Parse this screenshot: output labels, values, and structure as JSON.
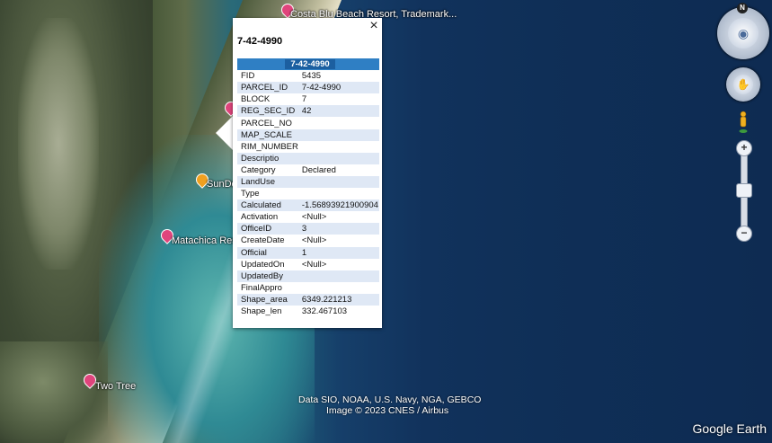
{
  "map": {
    "places": [
      {
        "name": "Costa Blu Beach Resort, Trademark...",
        "color": "#e0447c"
      },
      {
        "name": "SunDe",
        "color": "#f0a020"
      },
      {
        "name": "Matachica Resor",
        "color": "#e0447c"
      },
      {
        "name": "Two Tree",
        "color": "#e0447c"
      }
    ],
    "credits": {
      "line1": "Data SIO, NOAA, U.S. Navy, NGA, GEBCO",
      "line2": "Image © 2023 CNES / Airbus"
    },
    "logo": "Google Earth"
  },
  "popup": {
    "title": "7-42-4990",
    "header": "7-42-4990",
    "close_icon": "×",
    "rows": [
      {
        "key": "FID",
        "value": "5435"
      },
      {
        "key": "PARCEL_ID",
        "value": "7-42-4990"
      },
      {
        "key": "BLOCK",
        "value": "7"
      },
      {
        "key": "REG_SEC_ID",
        "value": "42"
      },
      {
        "key": "PARCEL_NO",
        "value": ""
      },
      {
        "key": "MAP_SCALE",
        "value": ""
      },
      {
        "key": "RIM_NUMBER",
        "value": ""
      },
      {
        "key": "Descriptio",
        "value": ""
      },
      {
        "key": "Category",
        "value": "Declared"
      },
      {
        "key": "LandUse",
        "value": ""
      },
      {
        "key": "Type",
        "value": ""
      },
      {
        "key": "Calculated",
        "value": "-1.56893921900904"
      },
      {
        "key": "Activation",
        "value": "<Null>"
      },
      {
        "key": "OfficeID",
        "value": "3"
      },
      {
        "key": "CreateDate",
        "value": "<Null>"
      },
      {
        "key": "Official",
        "value": "1"
      },
      {
        "key": "UpdatedOn",
        "value": "<Null>"
      },
      {
        "key": "UpdatedBy",
        "value": ""
      },
      {
        "key": "FinalAppro",
        "value": ""
      },
      {
        "key": "Shape_area",
        "value": "6349.221213"
      },
      {
        "key": "Shape_len",
        "value": "332.467103"
      }
    ]
  },
  "controls": {
    "compass_label": "N",
    "zoom_in": "+",
    "zoom_out": "−",
    "zoom_level_fraction": 0.48,
    "icons": [
      "compass-ring-icon",
      "look-joystick-icon",
      "move-hand-icon",
      "pegman-icon",
      "zoom-in-icon",
      "zoom-out-icon"
    ]
  }
}
